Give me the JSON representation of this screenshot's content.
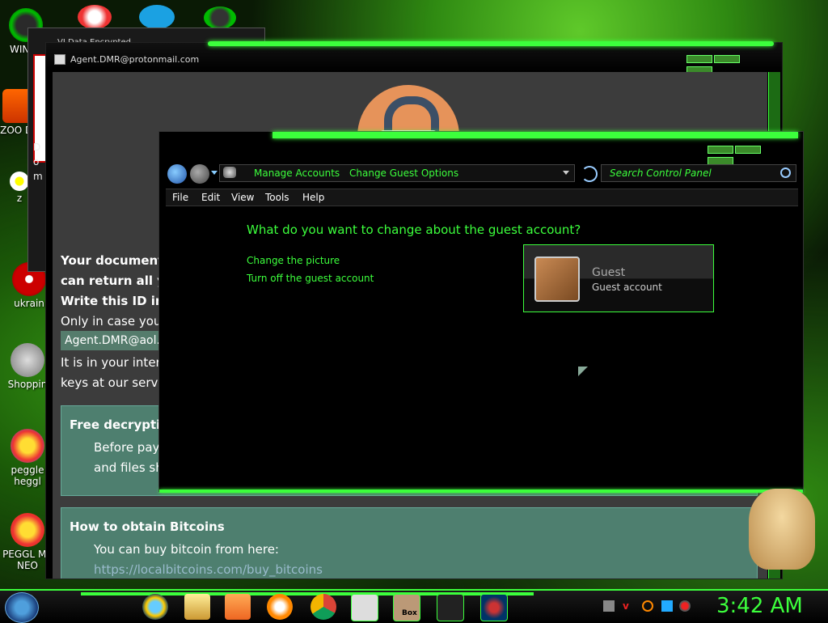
{
  "desktop": {
    "icons": [
      {
        "label": "WIN VI"
      },
      {
        "label": "ZOO DE"
      },
      {
        "label": "z"
      },
      {
        "label": "ukrain"
      },
      {
        "label": "Shoppin"
      },
      {
        "label": "peggle heggl"
      },
      {
        "label": "PEGGL ME NEO"
      }
    ],
    "bg_title_fragment": "VI Data Encrypted"
  },
  "ransom_window": {
    "title": "Agent.DMR@protonmail.com",
    "side_fragment_1": "D",
    "side_fragment_2": "o",
    "side_fragment_3": "m",
    "line1": "Your documents",
    "line2": "can return all yo",
    "line3": "Write this ID in",
    "line4": "Only in case you c",
    "email_box": "Agent.DMR@aol.c",
    "line5": "It is in your interes",
    "line6": "keys at our server",
    "panel1": {
      "heading": "Free decryptio",
      "text1": "Before payir",
      "text2": "and files sho"
    },
    "panel2": {
      "heading": "How to obtain Bitcoins",
      "text1": "You can buy bitcoin from here:",
      "text2": "https://localbitcoins.com/buy_bitcoins"
    }
  },
  "control_panel": {
    "breadcrumb": [
      "Manage Accounts",
      "Change Guest Options"
    ],
    "search_placeholder": "Search Control Panel",
    "menu": [
      "File",
      "Edit",
      "View",
      "Tools",
      "Help"
    ],
    "heading": "What do you want to change about the guest account?",
    "links": [
      "Change the picture",
      "Turn off the guest account"
    ],
    "account": {
      "name": "Guest",
      "type": "Guest account"
    }
  },
  "taskbar": {
    "clock": "3:42 AM",
    "box_label": "Box",
    "colors": {
      "accent": "#3cff3c"
    }
  }
}
